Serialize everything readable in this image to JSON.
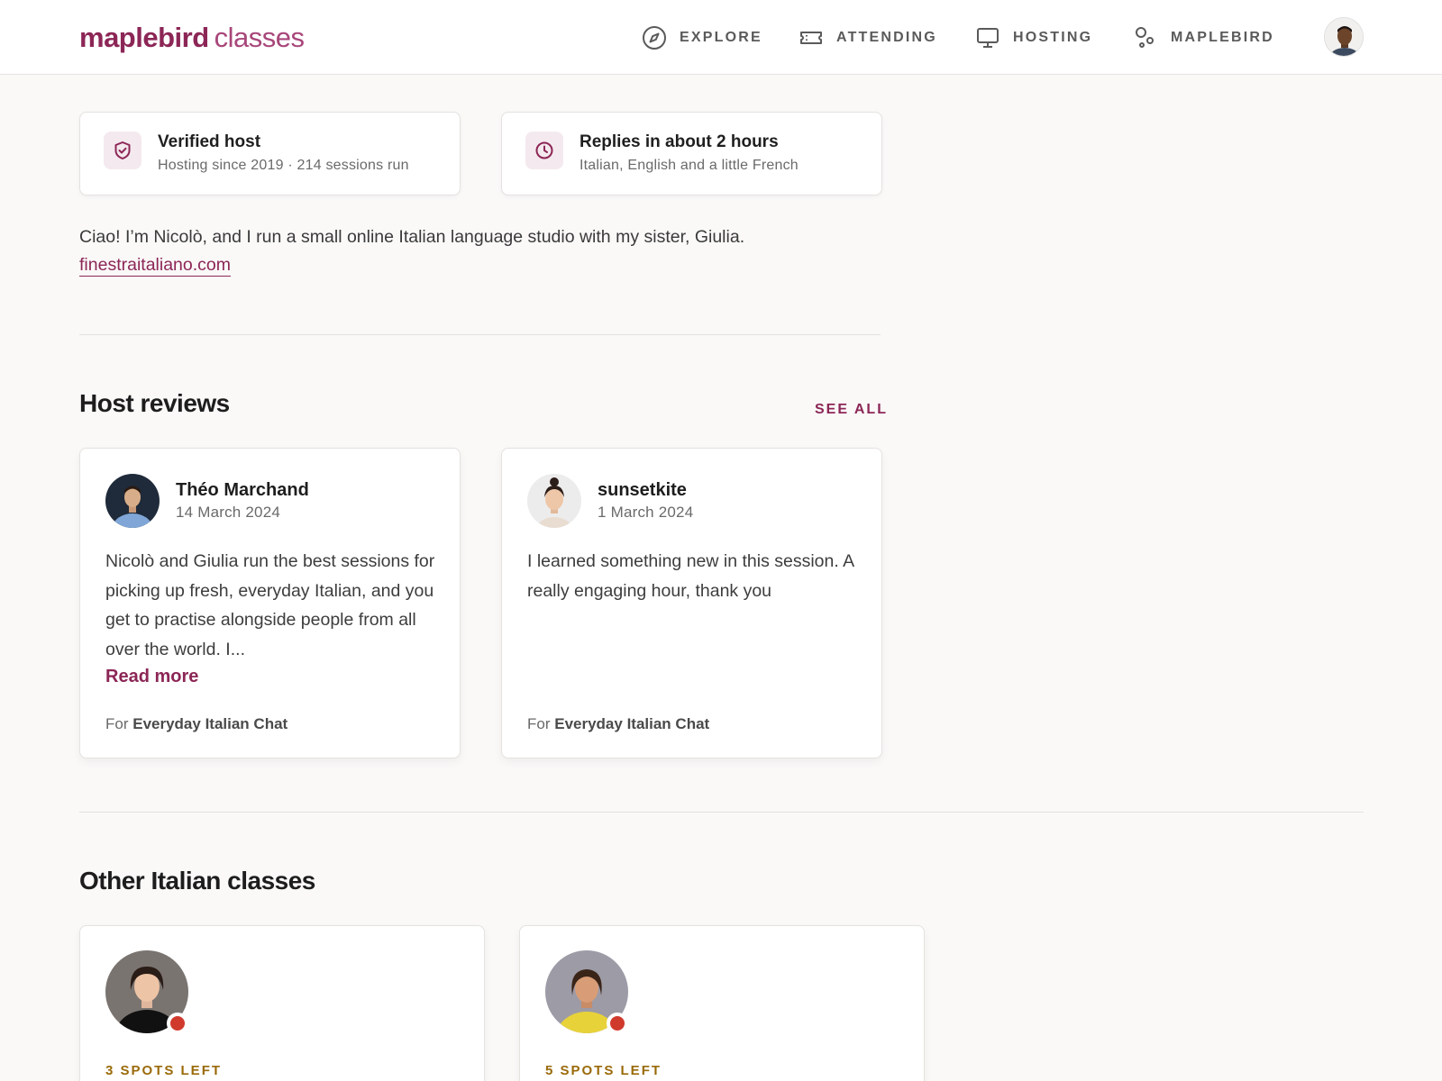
{
  "header": {
    "brand": "maplebird",
    "product": "classes",
    "nav": [
      {
        "label": "EXPLORE",
        "icon": "compass-icon"
      },
      {
        "label": "ATTENDING",
        "icon": "ticket-icon"
      },
      {
        "label": "HOSTING",
        "icon": "monitor-icon"
      },
      {
        "label": "MAPLEBIRD",
        "icon": "shapes-icon"
      }
    ]
  },
  "info_cards": [
    {
      "title": "Verified host",
      "subtitle": "Hosting since 2019 · 214 sessions run",
      "icon": "shield-check-icon"
    },
    {
      "title": "Replies in about 2 hours",
      "subtitle": "Italian, English and a little French",
      "icon": "clock-icon"
    }
  ],
  "bio": {
    "text": "Ciao! I’m Nicolò, and I run a small online Italian language studio with my sister, Giulia.",
    "link": "finestraitaliano.com"
  },
  "reviews_section": {
    "title": "Host reviews",
    "see_all": "SEE ALL",
    "reviews": [
      {
        "name": "Théo Marchand",
        "date": "14 March 2024",
        "text": "Nicolò and Giulia run the best sessions for picking up fresh, everyday Italian, and you get to practise alongside people from all over the world. I...",
        "read_more": "Read more",
        "for_prefix": "For",
        "for_class": "Everyday Italian Chat"
      },
      {
        "name": "sunsetkite",
        "date": "1 March 2024",
        "text": "I learned something new in this session. A really engaging hour, thank you",
        "for_prefix": "For",
        "for_class": "Everyday Italian Chat"
      }
    ]
  },
  "other_classes": {
    "title": "Other Italian classes",
    "classes": [
      {
        "spots": "3 SPOTS LEFT"
      },
      {
        "spots": "5 SPOTS LEFT"
      }
    ]
  },
  "colors": {
    "accent": "#8c2656",
    "spots": "#9a6a0a",
    "live_dot": "#d03a2c"
  }
}
